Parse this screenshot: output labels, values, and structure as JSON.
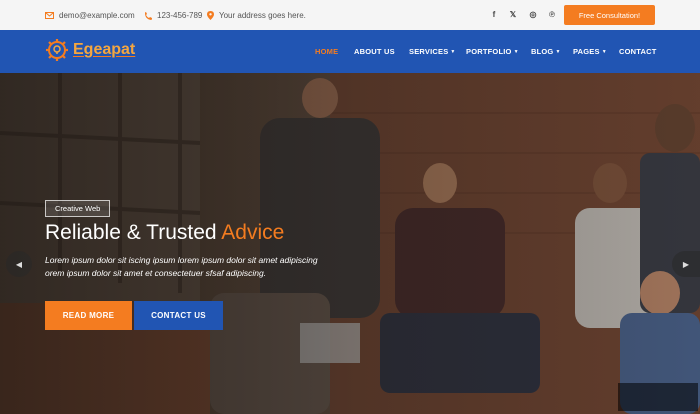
{
  "topbar": {
    "email": "demo@example.com",
    "phone": "123-456-789",
    "address": "Your address goes here.",
    "social": [
      {
        "icon": "facebook-icon",
        "glyph": "f"
      },
      {
        "icon": "x-twitter-icon",
        "glyph": "𝕏"
      },
      {
        "icon": "instagram-icon",
        "glyph": "◎"
      },
      {
        "icon": "pinterest-icon",
        "glyph": "℗"
      }
    ],
    "cta_label": "Free Consultation!"
  },
  "brand": {
    "name": "Egeapat"
  },
  "nav": {
    "home": "HOME",
    "about": "ABOUT US",
    "services": "SERVICES",
    "portfolio": "PORTFOLIO",
    "blog": "BLOG",
    "pages": "PAGES",
    "contact": "CONTACT"
  },
  "hero": {
    "tag": "Creative Web",
    "title_main": "Reliable & Trusted ",
    "title_accent": "Advice",
    "text": "Lorem ipsum dolor sit iscing ipsum lorem ipsum dolor sit amet adipiscing orem ipsum dolor sit amet et consectetuer sfsaf adipiscing.",
    "btn_more": "READ MORE",
    "btn_contact": "CONTACT US"
  },
  "colors": {
    "accent": "#f47c20",
    "brand_blue": "#2155b3"
  }
}
